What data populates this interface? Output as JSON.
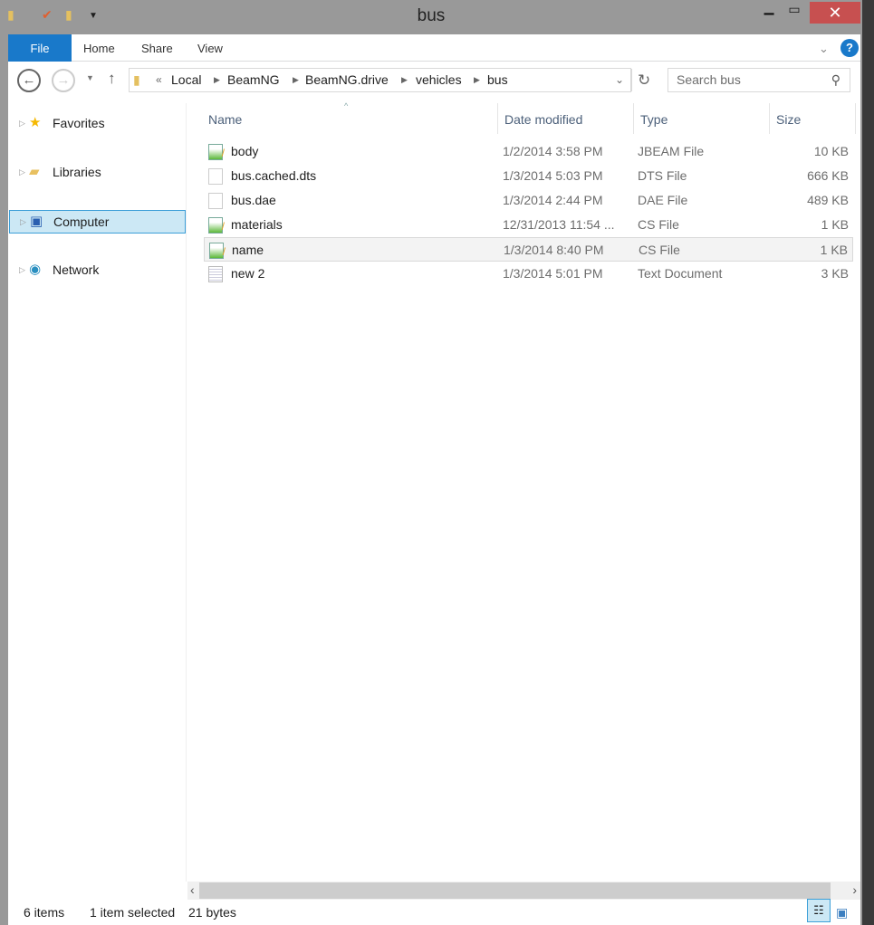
{
  "window": {
    "title": "bus"
  },
  "ribbon": {
    "tabs": [
      "File",
      "Home",
      "Share",
      "View"
    ]
  },
  "address": {
    "overflow": "«",
    "crumbs": [
      "Local",
      "BeamNG",
      "BeamNG.drive",
      "vehicles",
      "bus"
    ],
    "search_placeholder": "Search bus"
  },
  "nav": {
    "items": [
      {
        "label": "Favorites",
        "icon": "star-icon"
      },
      {
        "label": "Libraries",
        "icon": "libraries-icon"
      },
      {
        "label": "Computer",
        "icon": "computer-icon",
        "selected": true
      },
      {
        "label": "Network",
        "icon": "network-icon"
      }
    ]
  },
  "columns": [
    "Name",
    "Date modified",
    "Type",
    "Size"
  ],
  "files": [
    {
      "name": "body",
      "date": "1/2/2014 3:58 PM",
      "type": "JBEAM File",
      "size": "10 KB",
      "icon": "editor-icon"
    },
    {
      "name": "bus.cached.dts",
      "date": "1/3/2014 5:03 PM",
      "type": "DTS File",
      "size": "666 KB",
      "icon": "file-icon"
    },
    {
      "name": "bus.dae",
      "date": "1/3/2014 2:44 PM",
      "type": "DAE File",
      "size": "489 KB",
      "icon": "file-icon"
    },
    {
      "name": "materials",
      "date": "12/31/2013 11:54 ...",
      "type": "CS File",
      "size": "1 KB",
      "icon": "editor-icon"
    },
    {
      "name": "name",
      "date": "1/3/2014 8:40 PM",
      "type": "CS File",
      "size": "1 KB",
      "icon": "editor-icon",
      "selected": true
    },
    {
      "name": "new  2",
      "date": "1/3/2014 5:01 PM",
      "type": "Text Document",
      "size": "3 KB",
      "icon": "text-file-icon"
    }
  ],
  "status": {
    "count": "6 items",
    "selection": "1 item selected",
    "size": "21 bytes"
  },
  "colors": {
    "accent": "#1979ca",
    "close": "#c75050",
    "selection": "#cce8f5"
  }
}
